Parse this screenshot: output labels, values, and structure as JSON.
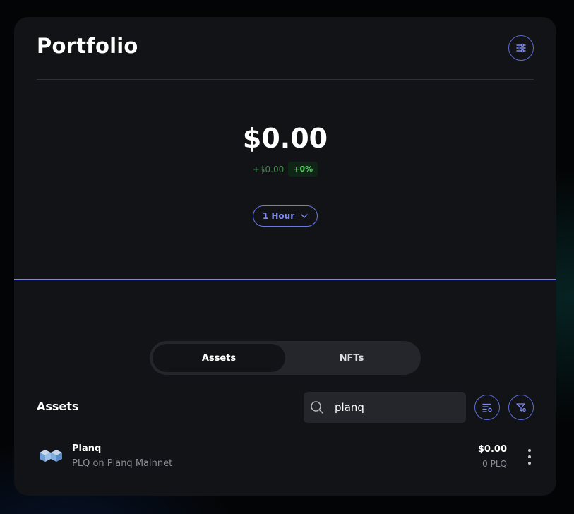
{
  "portfolio": {
    "title": "Portfolio",
    "balance": "$0.00",
    "change_amount": "+$0.00",
    "change_percent": "+0%",
    "time_range": "1 Hour"
  },
  "tabs": [
    {
      "label": "Assets",
      "active": true
    },
    {
      "label": "NFTs",
      "active": false
    }
  ],
  "assets_section": {
    "title": "Assets",
    "search_value": "planq"
  },
  "assets": [
    {
      "name": "Planq",
      "network": "PLQ on Planq Mainnet",
      "value": "$0.00",
      "quantity": "0 PLQ"
    }
  ],
  "colors": {
    "accent": "#6b78e8",
    "positive": "#4fd15d",
    "card_bg": "#121317"
  },
  "icons": {
    "settings": "sliders-icon",
    "search": "search-icon",
    "sort": "sort-list-icon",
    "filter": "filter-icon",
    "chevron": "chevron-down-icon",
    "more": "more-vertical-icon"
  }
}
